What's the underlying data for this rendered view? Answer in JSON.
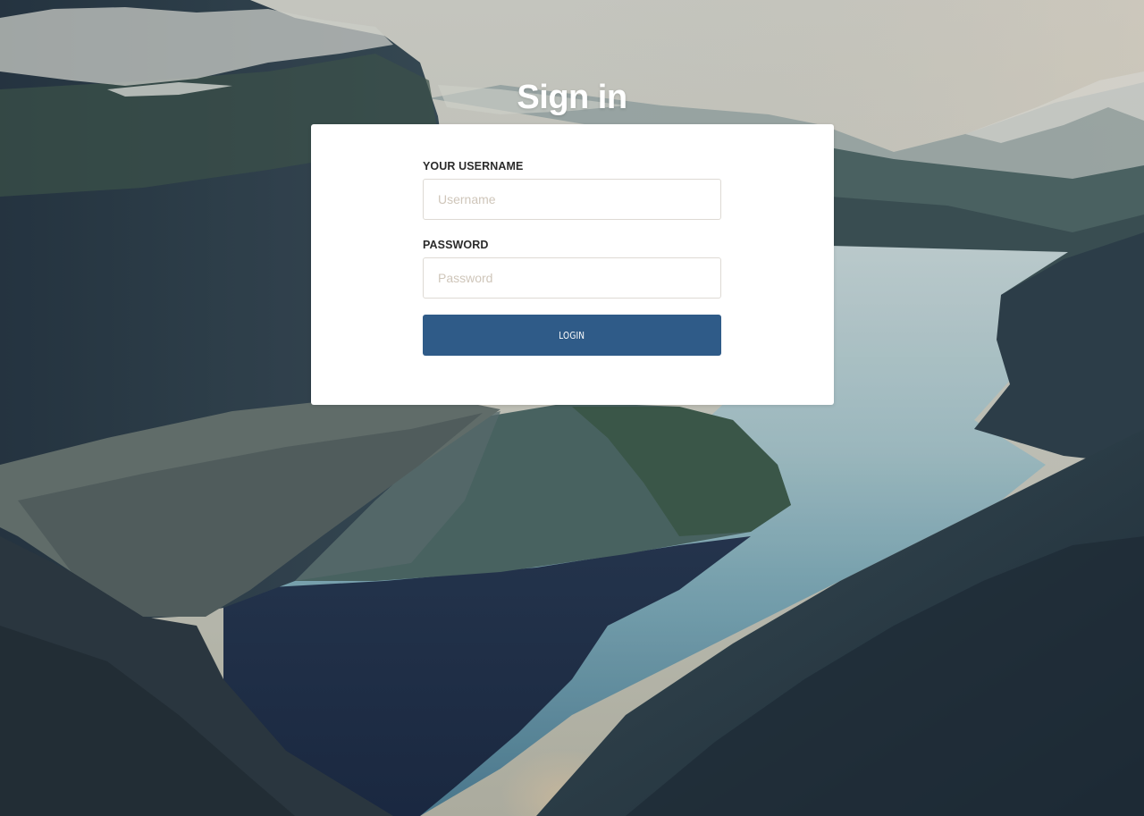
{
  "page": {
    "title": "Sign in"
  },
  "login_form": {
    "username": {
      "label": "YOUR USERNAME",
      "placeholder": "Username",
      "value": ""
    },
    "password": {
      "label": "PASSWORD",
      "placeholder": "Password",
      "value": ""
    },
    "submit_label": "LOGIN"
  },
  "colors": {
    "button": "#2f5b88",
    "card": "#ffffff",
    "title": "#ffffff",
    "input_border": "#dedad4",
    "placeholder": "#cfc6ba"
  }
}
